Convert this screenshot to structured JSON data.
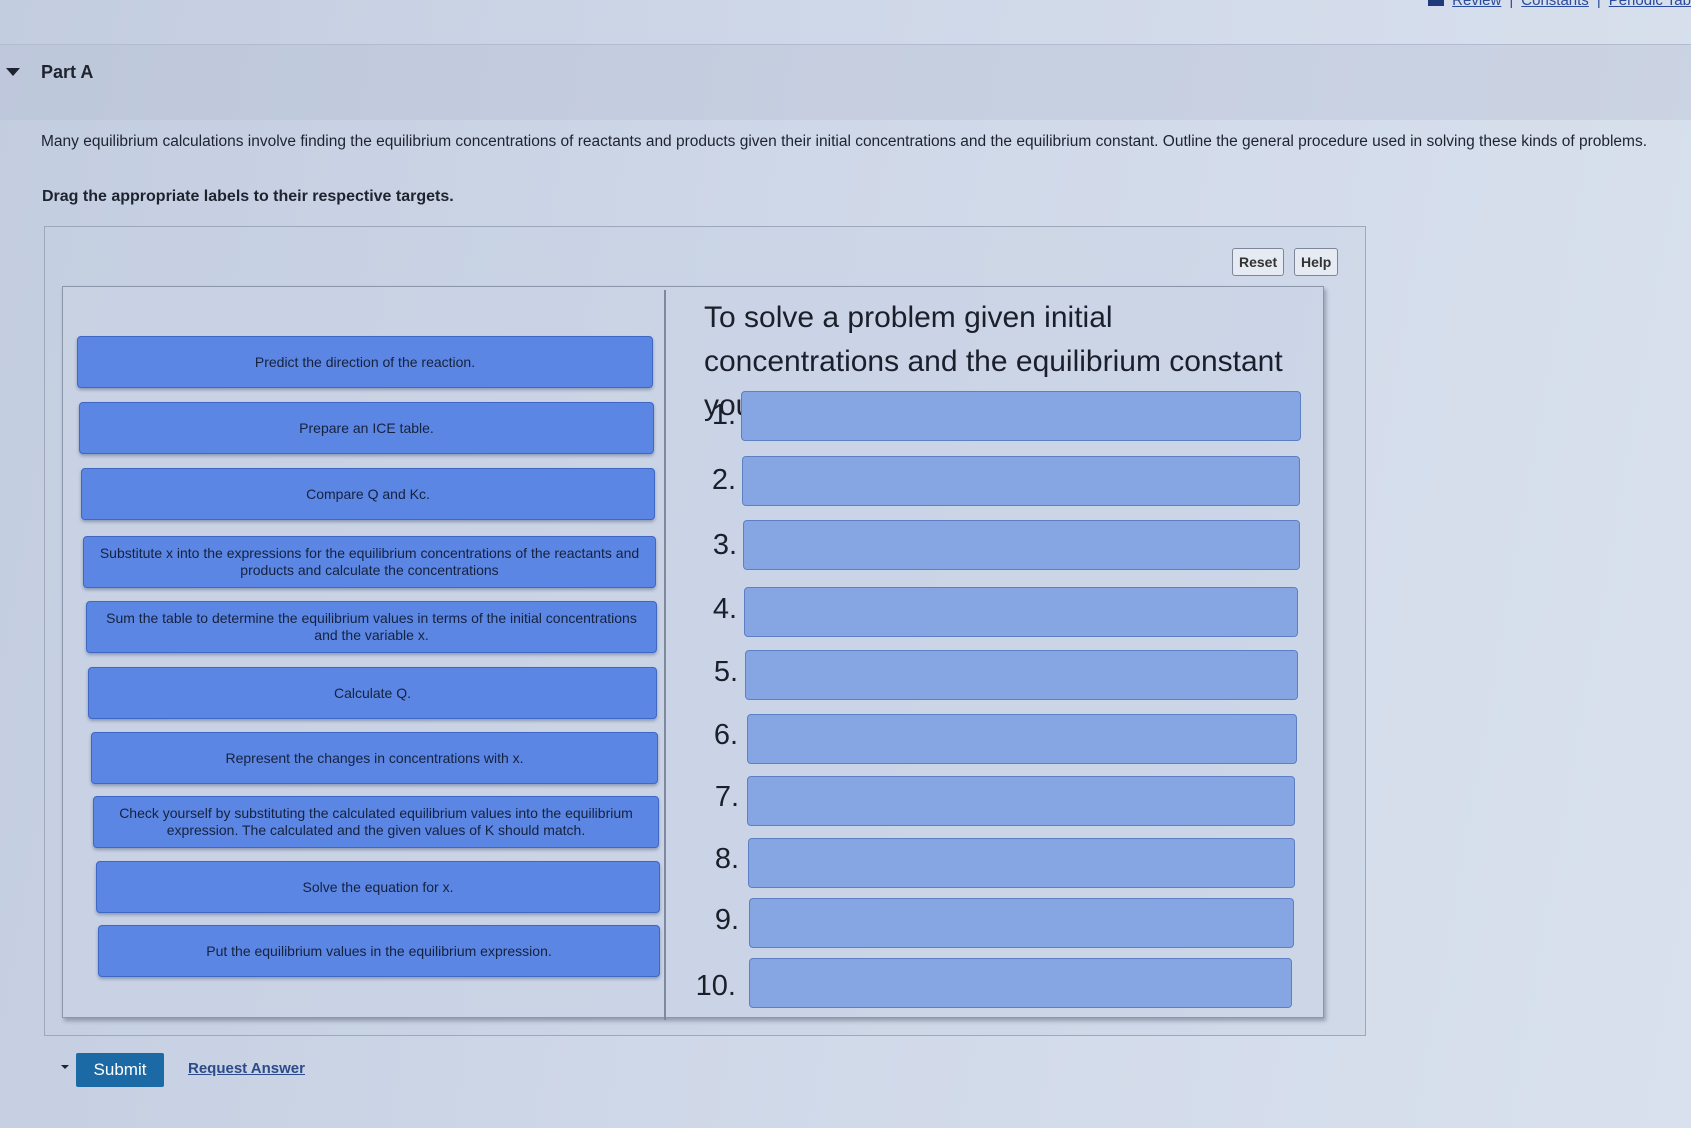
{
  "header": {
    "links": [
      "Review",
      "Constants",
      "Periodic Tab"
    ]
  },
  "part": {
    "title": "Part A"
  },
  "question": {
    "text": "Many equilibrium calculations involve finding the equilibrium concentrations of reactants and products given their initial concentrations and the equilibrium constant. Outline the general procedure used in solving these kinds of problems.",
    "instruction": "Drag the appropriate labels to their respective targets."
  },
  "toolbar": {
    "reset_label": "Reset",
    "help_label": "Help"
  },
  "labels": [
    "Predict the direction of the reaction.",
    "Prepare an ICE table.",
    "Compare Q and Kc.",
    "Substitute x into the expressions for the equilibrium concentrations of the reactants and products and calculate the concentrations",
    "Sum the table to determine the equilibrium values in terms of the initial concentrations and the variable x.",
    "Calculate Q.",
    "Represent the changes in concentrations with x.",
    "Check yourself by substituting the calculated equilibrium values into the equilibrium expression. The calculated and the given values of K should match.",
    "Solve the equation for x.",
    "Put the equilibrium values in the equilibrium expression."
  ],
  "targets": {
    "title": "To solve a problem given initial concentrations and the equilibrium constant you would",
    "numbers": [
      "1.",
      "2.",
      "3.",
      "4.",
      "5.",
      "6.",
      "7.",
      "8.",
      "9.",
      "10."
    ]
  },
  "footer": {
    "submit_label": "Submit",
    "request_label": "Request Answer"
  },
  "colors": {
    "label_bg": "#5c86e3",
    "target_bg": "#86a6e3",
    "submit_bg": "#1b6aa5"
  }
}
